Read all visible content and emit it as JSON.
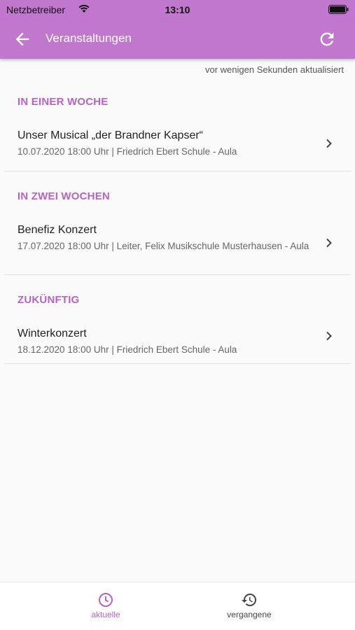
{
  "status": {
    "carrier": "Netzbetreiber",
    "time": "13:10"
  },
  "appbar": {
    "title": "Veranstaltungen"
  },
  "updated_text": "vor wenigen Sekunden aktualisiert",
  "sections": [
    {
      "header": "IN EINER WOCHE",
      "item": {
        "title": "Unser Musical „der Brandner Kapser“",
        "subtitle": "10.07.2020 18:00 Uhr | Friedrich Ebert Schule - Aula"
      }
    },
    {
      "header": "IN ZWEI WOCHEN",
      "item": {
        "title": "Benefiz Konzert",
        "subtitle": "17.07.2020 18:00 Uhr | Leiter, Felix Musikschule Musterhausen - Aula"
      }
    },
    {
      "header": "ZUKÜNFTIG",
      "item": {
        "title": "Winterkonzert",
        "subtitle": "18.12.2020 18:00 Uhr | Friedrich Ebert Schule - Aula"
      }
    }
  ],
  "bottom_nav": {
    "current": {
      "label": "aktuelle",
      "icon": "clock-icon",
      "color": "#b862c6"
    },
    "past": {
      "label": "vergangene",
      "icon": "history-icon",
      "color": "#444444"
    }
  },
  "colors": {
    "primary": "#c277cf",
    "accent": "#b862c6"
  }
}
